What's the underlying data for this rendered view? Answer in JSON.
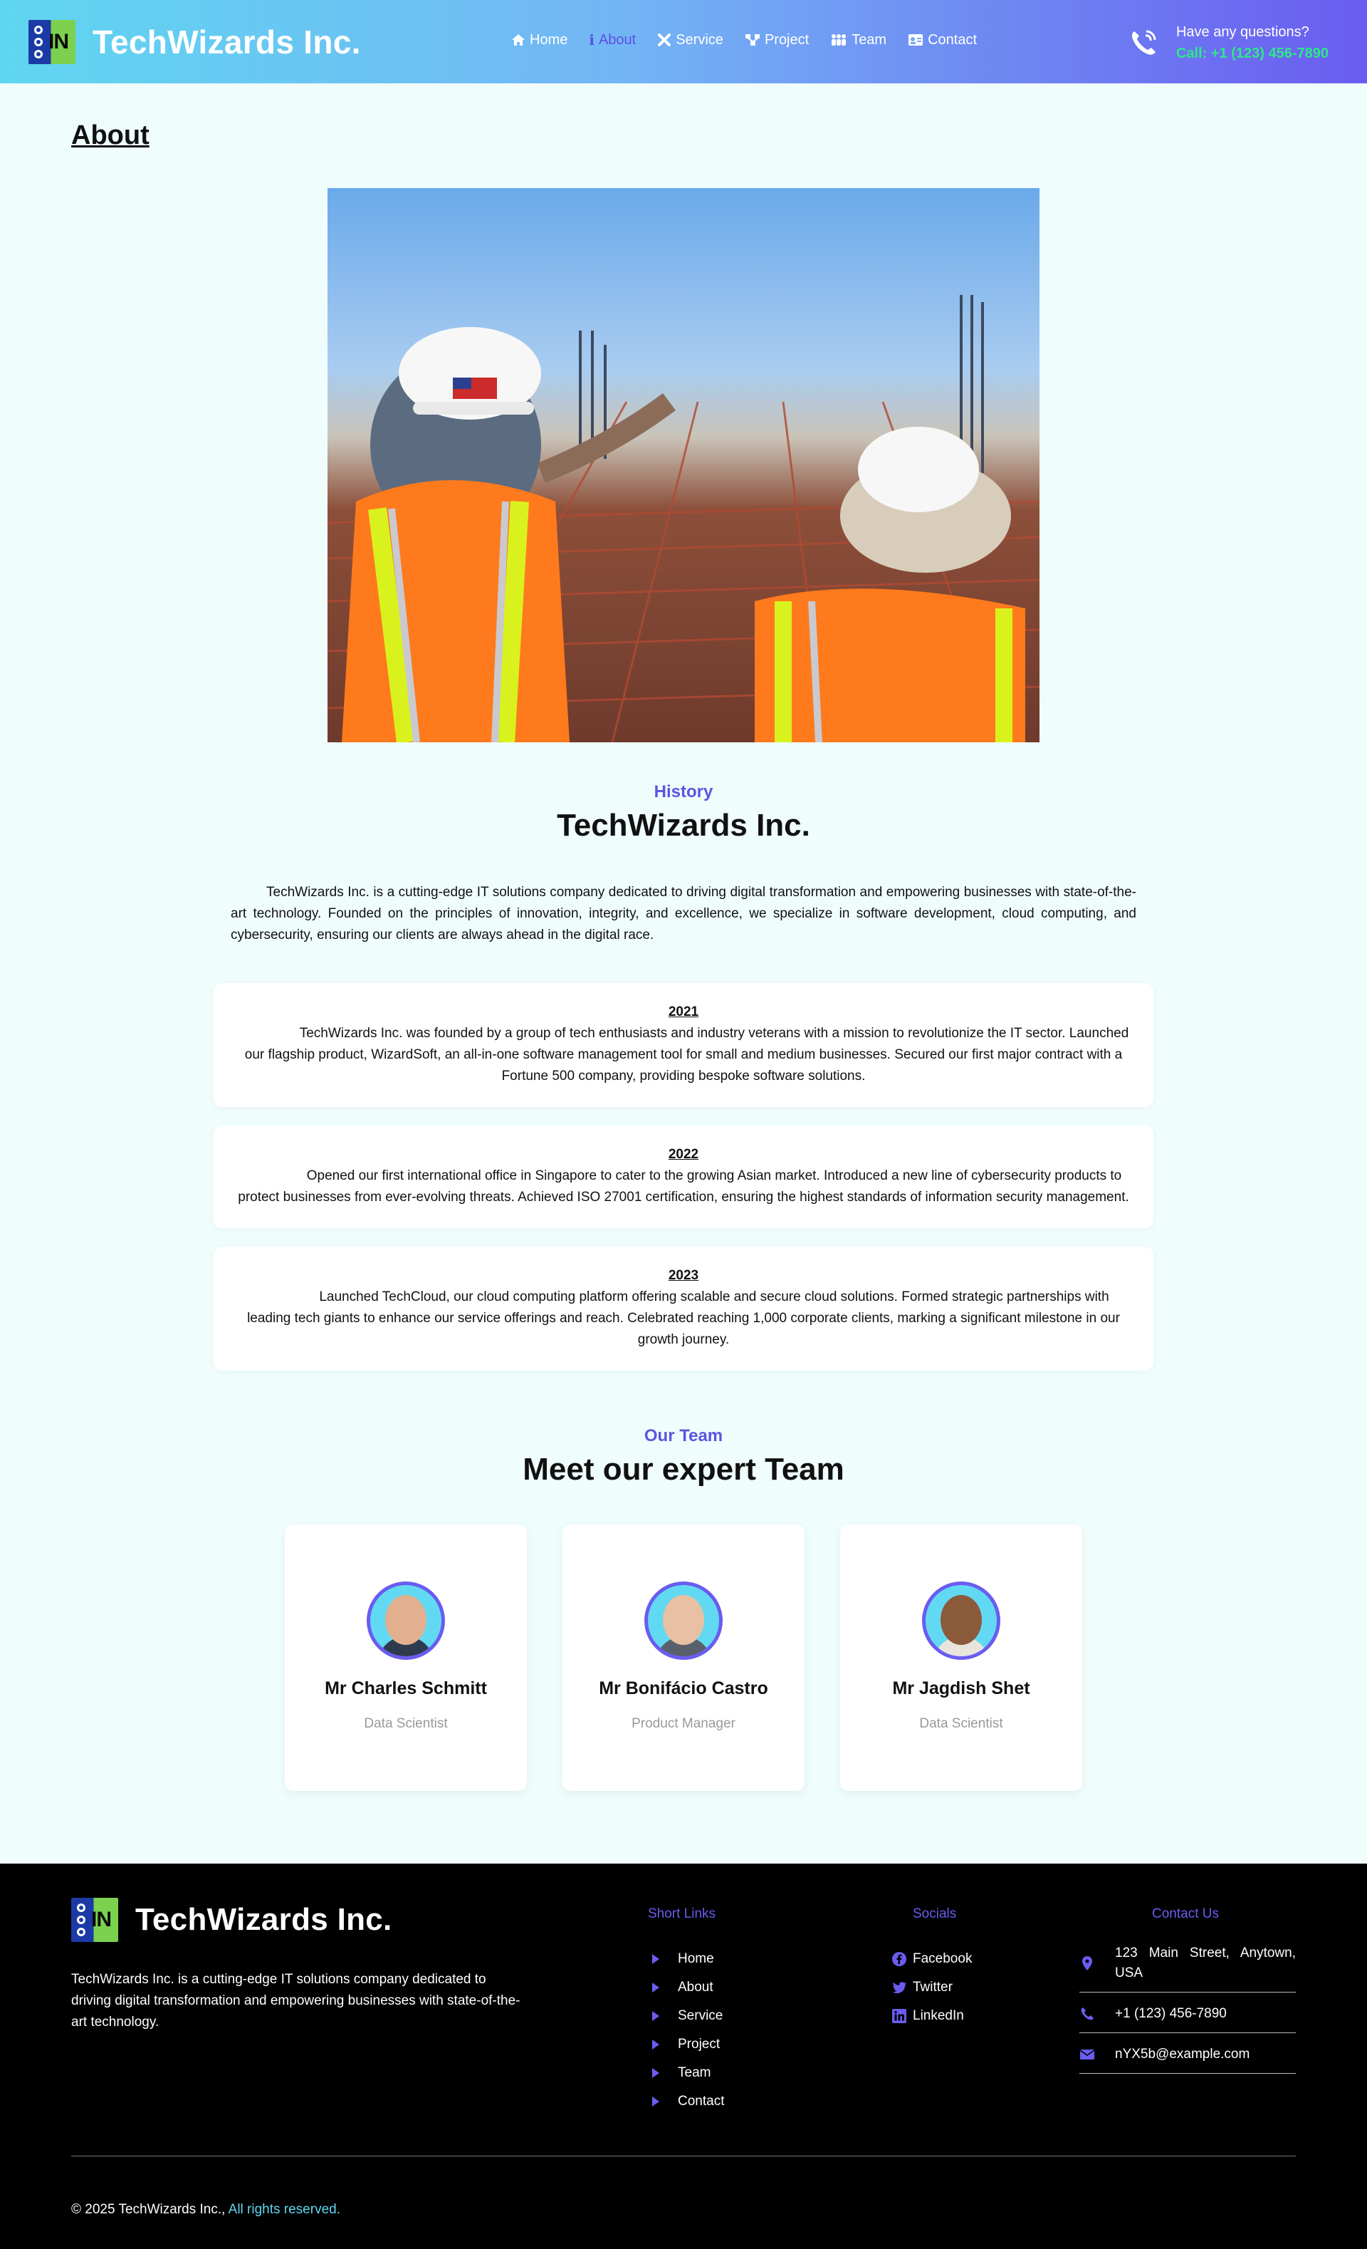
{
  "header": {
    "brand": "TechWizards Inc.",
    "logo_text": "IN",
    "nav": [
      {
        "label": "Home",
        "icon": "home-icon"
      },
      {
        "label": "About",
        "icon": "info-icon",
        "active": true
      },
      {
        "label": "Service",
        "icon": "tools-icon"
      },
      {
        "label": "Project",
        "icon": "project-icon"
      },
      {
        "label": "Team",
        "icon": "team-icon"
      },
      {
        "label": "Contact",
        "icon": "contact-card-icon"
      }
    ],
    "questions": "Have any questions?",
    "call": "Call: +1 (123) 456-7890"
  },
  "main": {
    "page_title": "About",
    "history": {
      "eyebrow": "History",
      "heading": "TechWizards Inc.",
      "intro": "TechWizards Inc. is a cutting-edge IT solutions company dedicated to driving digital transformation and empowering businesses with state-of-the-art technology. Founded on the principles of innovation, integrity, and excellence, we specialize in software development, cloud computing, and cybersecurity, ensuring our clients are always ahead in the digital race."
    },
    "timeline": [
      {
        "year": "2021",
        "desc": "TechWizards Inc. was founded by a group of tech enthusiasts and industry veterans with a mission to revolutionize the IT sector. Launched our flagship product, WizardSoft, an all-in-one software management tool for small and medium businesses. Secured our first major contract with a Fortune 500 company, providing bespoke software solutions."
      },
      {
        "year": "2022",
        "desc": "Opened our first international office in Singapore to cater to the growing Asian market. Introduced a new line of cybersecurity products to protect businesses from ever-evolving threats. Achieved ISO 27001 certification, ensuring the highest standards of information security management."
      },
      {
        "year": "2023",
        "desc": "Launched TechCloud, our cloud computing platform offering scalable and secure cloud solutions. Formed strategic partnerships with leading tech giants to enhance our service offerings and reach. Celebrated reaching 1,000 corporate clients, marking a significant milestone in our growth journey."
      }
    ],
    "team": {
      "eyebrow": "Our Team",
      "heading": "Meet our expert Team",
      "members": [
        {
          "name": "Mr Charles Schmitt",
          "role": "Data Scientist"
        },
        {
          "name": "Mr Bonifácio Castro",
          "role": "Product Manager"
        },
        {
          "name": "Mr Jagdish Shet",
          "role": "Data Scientist"
        }
      ]
    }
  },
  "footer": {
    "brand": "TechWizards Inc.",
    "description": "TechWizards Inc. is a cutting-edge IT solutions company dedicated to driving digital transformation and empowering businesses with state-of-the-art technology.",
    "short_links_title": "Short Links",
    "short_links": [
      "Home",
      "About",
      "Service",
      "Project",
      "Team",
      "Contact"
    ],
    "socials_title": "Socials",
    "socials": [
      {
        "label": "Facebook",
        "icon": "facebook-icon"
      },
      {
        "label": "Twitter",
        "icon": "twitter-icon"
      },
      {
        "label": "LinkedIn",
        "icon": "linkedin-icon"
      }
    ],
    "contact_title": "Contact Us",
    "contact": {
      "address": "123 Main Street, Anytown, USA",
      "phone": "+1 (123) 456-7890",
      "email": "nYX5b@example.com"
    },
    "copyright": "© 2025 TechWizards Inc.,",
    "rights": "All rights reserved."
  },
  "colors": {
    "accent": "#6a5cf0",
    "cyan": "#5fd6f0",
    "call_green": "#2ee88a",
    "footer_bg": "#000000",
    "page_bg": "#f0fdfd"
  }
}
